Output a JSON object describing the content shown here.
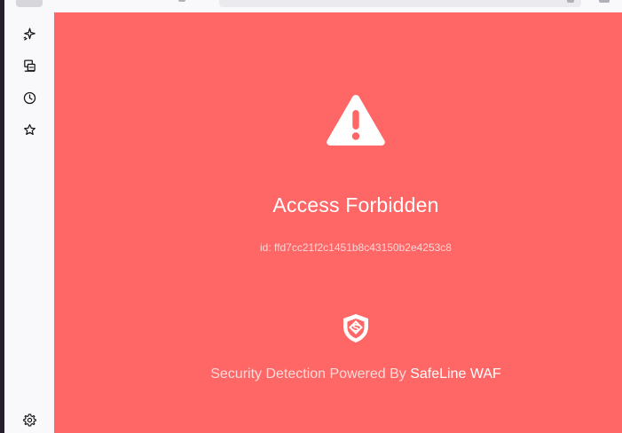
{
  "browser": {
    "url_fragment": "(   )   .                  .                    (   )(   )"
  },
  "sidebar": {
    "items": [
      {
        "icon": "sparkle-icon",
        "label": ""
      },
      {
        "icon": "synced-tabs-icon",
        "label": ""
      },
      {
        "icon": "history-clock-icon",
        "label": ""
      },
      {
        "icon": "bookmark-star-icon",
        "label": ""
      }
    ],
    "settings_icon": "gear-icon"
  },
  "page": {
    "background_color": "#ff6666",
    "title": "Access Forbidden",
    "event_id": "id: ffd7cc21f2c1451b8c43150b2e4253c8",
    "powered_by_text": "Security Detection Powered By",
    "brand_link": "SafeLine WAF",
    "warning_icon": "warning-triangle-icon",
    "brand_icon": "safeline-shield-icon"
  }
}
